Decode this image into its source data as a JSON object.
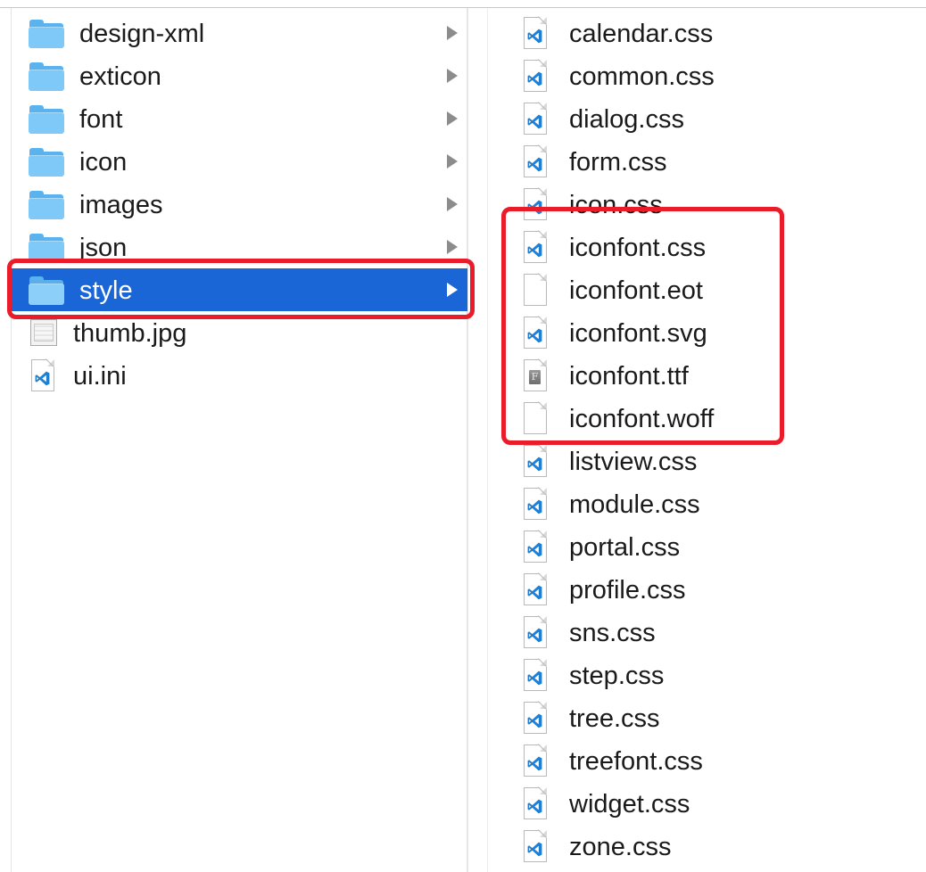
{
  "left_column": {
    "items": [
      {
        "label": "design-xml",
        "icon": "folder-icon",
        "has_children": true,
        "selected": false
      },
      {
        "label": "exticon",
        "icon": "folder-icon",
        "has_children": true,
        "selected": false
      },
      {
        "label": "font",
        "icon": "folder-icon",
        "has_children": true,
        "selected": false
      },
      {
        "label": "icon",
        "icon": "folder-icon",
        "has_children": true,
        "selected": false
      },
      {
        "label": "images",
        "icon": "folder-icon",
        "has_children": true,
        "selected": false
      },
      {
        "label": "json",
        "icon": "folder-icon",
        "has_children": true,
        "selected": false
      },
      {
        "label": "style",
        "icon": "folder-icon",
        "has_children": true,
        "selected": true
      },
      {
        "label": "thumb.jpg",
        "icon": "image-file-icon",
        "has_children": false,
        "selected": false
      },
      {
        "label": "ui.ini",
        "icon": "vscode-file-icon",
        "has_children": false,
        "selected": false
      }
    ]
  },
  "right_column": {
    "items": [
      {
        "label": "calendar.css",
        "icon": "vscode-file-icon"
      },
      {
        "label": "common.css",
        "icon": "vscode-file-icon"
      },
      {
        "label": "dialog.css",
        "icon": "vscode-file-icon"
      },
      {
        "label": "form.css",
        "icon": "vscode-file-icon"
      },
      {
        "label": "icon.css",
        "icon": "vscode-file-icon"
      },
      {
        "label": "iconfont.css",
        "icon": "vscode-file-icon"
      },
      {
        "label": "iconfont.eot",
        "icon": "blank-file-icon"
      },
      {
        "label": "iconfont.svg",
        "icon": "vscode-file-icon"
      },
      {
        "label": "iconfont.ttf",
        "icon": "font-file-icon"
      },
      {
        "label": "iconfont.woff",
        "icon": "blank-file-icon"
      },
      {
        "label": "listview.css",
        "icon": "vscode-file-icon"
      },
      {
        "label": "module.css",
        "icon": "vscode-file-icon"
      },
      {
        "label": "portal.css",
        "icon": "vscode-file-icon"
      },
      {
        "label": "profile.css",
        "icon": "vscode-file-icon"
      },
      {
        "label": "sns.css",
        "icon": "vscode-file-icon"
      },
      {
        "label": "step.css",
        "icon": "vscode-file-icon"
      },
      {
        "label": "tree.css",
        "icon": "vscode-file-icon"
      },
      {
        "label": "treefont.css",
        "icon": "vscode-file-icon"
      },
      {
        "label": "widget.css",
        "icon": "vscode-file-icon"
      },
      {
        "label": "zone.css",
        "icon": "vscode-file-icon"
      }
    ]
  },
  "colors": {
    "selection": "#1a66d6",
    "annotation": "#ea1c2a",
    "folder": "#7ec9f7",
    "vscode_blue": "#1f7fd1"
  }
}
